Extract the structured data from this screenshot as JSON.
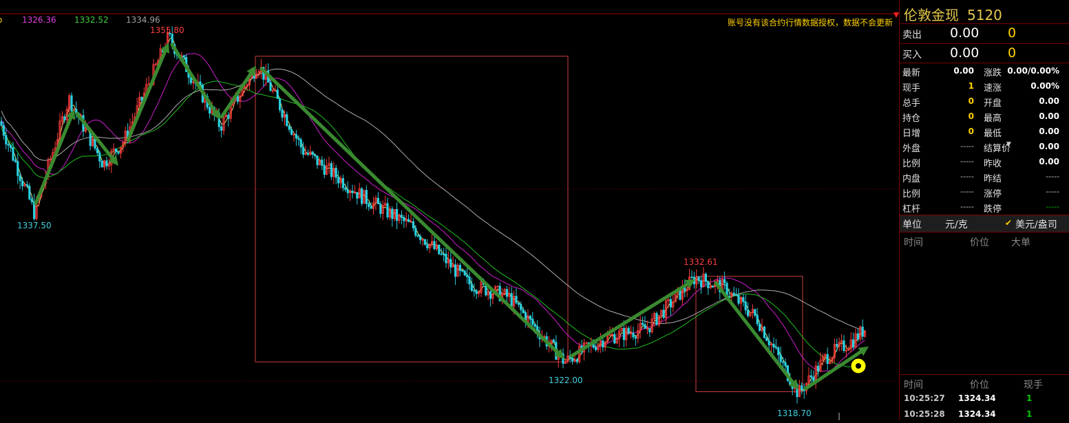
{
  "legend": {
    "ma1": "1326.36",
    "ma2": "1332.52",
    "ma3": "1334.96"
  },
  "notice": "账号没有该合约行情数据授权，数据不会更新",
  "annotations": {
    "high1": "1355.80",
    "low1": "1337.50",
    "low2": "1322.00",
    "high2": "1332.61",
    "low3": "1318.70"
  },
  "colors": {
    "up": "#ff3c3c",
    "down": "#28d0e0",
    "arrow": "#3a8a30",
    "box": "#d04040"
  },
  "quote": {
    "name": "伦敦金现",
    "code": "5120",
    "sell_label": "卖出",
    "sell_price": "0.00",
    "sell_vol": "0",
    "buy_label": "买入",
    "buy_price": "0.00",
    "buy_vol": "0",
    "left": [
      {
        "label": "最新",
        "value": "0.00"
      },
      {
        "label": "现手",
        "value": "1"
      },
      {
        "label": "总手",
        "value": "0"
      },
      {
        "label": "持仓",
        "value": "0"
      },
      {
        "label": "日增",
        "value": "0"
      },
      {
        "label": "外盘",
        "value": "-----"
      },
      {
        "label": "比例",
        "value": "-----"
      },
      {
        "label": "内盘",
        "value": "-----"
      },
      {
        "label": "比例",
        "value": "-----"
      },
      {
        "label": "杠杆",
        "value": "-----"
      }
    ],
    "right": [
      {
        "label": "涨跌",
        "value": "0.00/0.00%"
      },
      {
        "label": "速涨",
        "value": "0.00%"
      },
      {
        "label": "开盘",
        "value": "0.00"
      },
      {
        "label": "最高",
        "value": "0.00"
      },
      {
        "label": "最低",
        "value": "0.00"
      },
      {
        "label": "结算价",
        "value": "0.00"
      },
      {
        "label": "昨收",
        "value": "0.00"
      },
      {
        "label": "昨结",
        "value": "-----"
      },
      {
        "label": "涨停",
        "value": "-----"
      },
      {
        "label": "跌停",
        "value": "-----"
      }
    ],
    "unit_label": "单位",
    "unit_left": "元/克",
    "unit_right": "美元/盎司",
    "big_headers": {
      "time": "时间",
      "price": "价位",
      "big": "大单"
    },
    "tick_headers": {
      "time": "时间",
      "price": "价位",
      "vol": "现手"
    },
    "ticks": [
      {
        "time": "10:25:27",
        "price": "1324.34",
        "vol": "1"
      },
      {
        "time": "10:25:28",
        "price": "1324.34",
        "vol": "1"
      }
    ]
  },
  "chart_data": {
    "type": "candlestick",
    "ylim": [
      1316.5,
      1357.5
    ],
    "pivots": [
      [
        0,
        1347
      ],
      [
        50,
        1337.5
      ],
      [
        100,
        1349.4
      ],
      [
        150,
        1342.6
      ],
      [
        180,
        1345
      ],
      [
        245,
        1355.8
      ],
      [
        320,
        1346.5
      ],
      [
        375,
        1353
      ],
      [
        440,
        1344
      ],
      [
        530,
        1339
      ],
      [
        600,
        1336
      ],
      [
        680,
        1330.2
      ],
      [
        740,
        1328.7
      ],
      [
        820,
        1322
      ],
      [
        880,
        1324.5
      ],
      [
        940,
        1325.5
      ],
      [
        1010,
        1330.8
      ],
      [
        1050,
        1329.8
      ],
      [
        1100,
        1326.5
      ],
      [
        1160,
        1318.7
      ],
      [
        1200,
        1322.5
      ],
      [
        1240,
        1324.3
      ],
      [
        1256,
        1325.4
      ]
    ],
    "mas": [
      {
        "color": "#e8e070",
        "lag": 8,
        "offset": 0
      },
      {
        "color": "#d020d0",
        "lag": 60,
        "offset": 0.6
      },
      {
        "color": "#20c020",
        "lag": 120,
        "offset": -0.3
      },
      {
        "color": "#b0b0b0",
        "lag": 200,
        "offset": 1.5
      }
    ],
    "arrows": [
      [
        52,
        1338.5,
        108,
        1348.3
      ],
      [
        112,
        1347.8,
        172,
        1342.4
      ],
      [
        186,
        1345.1,
        245,
        1355.2
      ],
      [
        250,
        1355,
        320,
        1347.2
      ],
      [
        322,
        1347.5,
        372,
        1352.8
      ],
      [
        380,
        1352.5,
        820,
        1322.3
      ],
      [
        830,
        1322.6,
        1010,
        1330.6
      ],
      [
        1040,
        1330.2,
        1160,
        1319.1
      ],
      [
        1170,
        1319.2,
        1262,
        1323.6
      ]
    ],
    "boxes": [
      [
        371,
        825,
        1353.8,
        1322
      ],
      [
        1011,
        1166,
        1330.9,
        1318.9
      ]
    ]
  }
}
